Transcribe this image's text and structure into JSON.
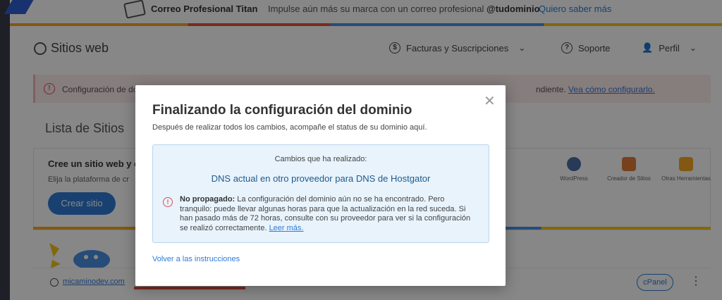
{
  "promo": {
    "brand": "Correo Profesional Titan",
    "message": "Impulse aún más su marca con un correo profesional",
    "handle": "@tudominio",
    "link": "Quiero saber más"
  },
  "header": {
    "title": "Sitios web",
    "nav": [
      {
        "label": "Facturas y Suscripciones"
      },
      {
        "label": "Soporte"
      },
      {
        "label": "Perfil"
      }
    ]
  },
  "alert": {
    "text": "Configuración de do",
    "text_tail": "ndiente.",
    "link": "Vea cómo configurarlo."
  },
  "sites": {
    "title": "Lista de Sitios",
    "create_heading": "Cree un sitio web y c",
    "create_sub": "Elija la plataforma de cr",
    "create_button": "Crear sitio",
    "tools": [
      {
        "label": "WordPress",
        "color": "#4a6fa5"
      },
      {
        "label": "Creador de Sitios",
        "color": "#e07b39"
      },
      {
        "label": "Otras Herramientas",
        "color": "#f5a623"
      }
    ],
    "domain": "micaminodev.com",
    "panel_button": "cPanel"
  },
  "modal": {
    "title": "Finalizando la configuración del dominio",
    "subtitle": "Después de realizar todos los cambios, acompañe el status de su dominio aquí.",
    "changes_label": "Cambios que ha realizado:",
    "change": "DNS actual en otro proveedor para DNS de Hostgator",
    "warning_title": "No propagado:",
    "warning_body": "La configuración del dominio aún no se ha encontrado. Pero tranquilo: puede llevar algunas horas para que la actualización en la red suceda. Si han pasado más de 72 horas, consulte con su proveedor para ver si la configuración se realizó correctamente.",
    "warning_link": "Leer más.",
    "back_link": "Volver a las instrucciones"
  }
}
